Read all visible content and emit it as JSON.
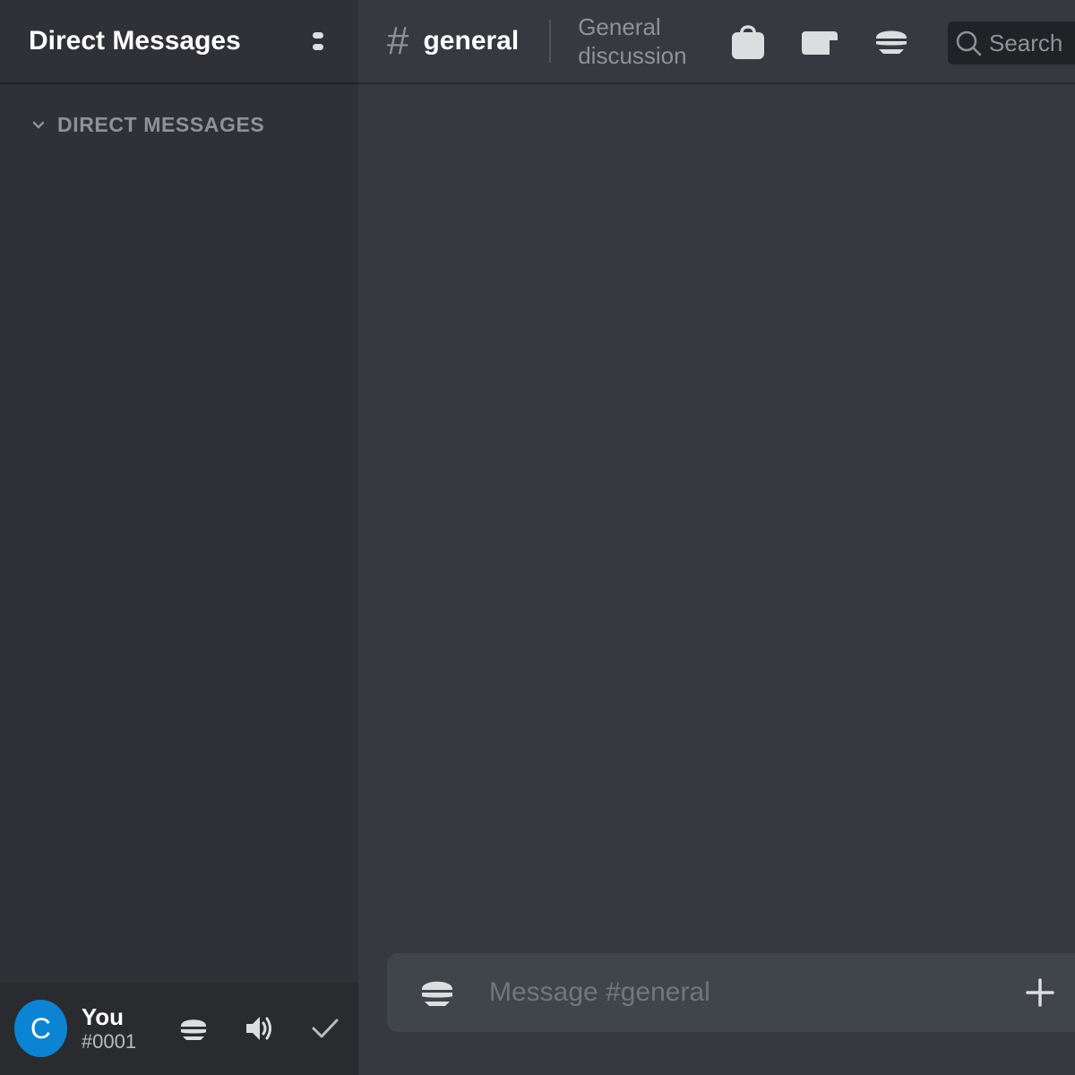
{
  "sidebar": {
    "title": "Direct Messages",
    "section_label": "DIRECT MESSAGES"
  },
  "user": {
    "avatar_letter": "C",
    "name": "You",
    "discriminator": "#0001"
  },
  "channel": {
    "hash": "#",
    "name": "general",
    "topic": "General discussion"
  },
  "search": {
    "placeholder": "Search"
  },
  "composer": {
    "placeholder": "Message #general"
  },
  "icons": {
    "sidebar_menu": "kebab-menu-icon",
    "section_toggle": "chevron-down-icon",
    "user_mic": "microphone-icon",
    "user_speaker": "speaker-icon",
    "user_status": "checkmark-icon",
    "header_bag": "bag-icon",
    "header_card": "card-icon",
    "header_members": "members-icon",
    "search": "search-icon",
    "composer_left": "attachment-icon",
    "composer_right": "plus-icon"
  },
  "colors": {
    "avatar": "#0b84d4",
    "sidebar_bg": "#2f3136",
    "main_bg": "#36393f",
    "composer_bg": "#40444b"
  }
}
